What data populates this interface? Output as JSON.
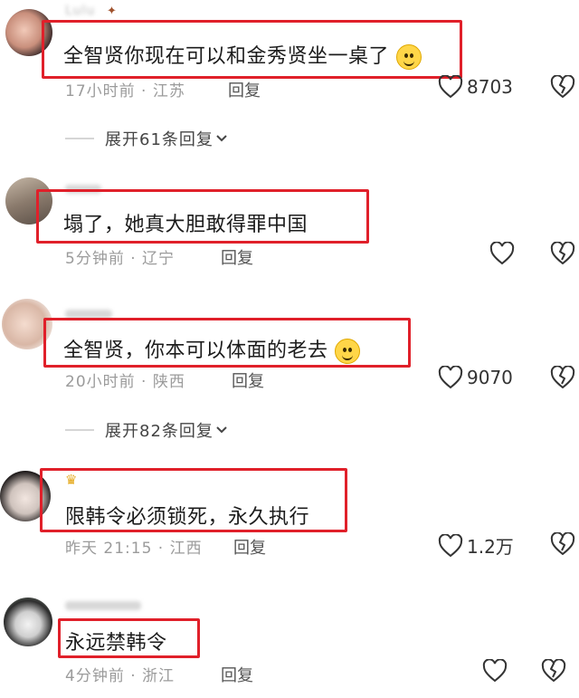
{
  "comments": [
    {
      "user": "Lulu",
      "text": "全智贤你现在可以和金秀贤坐一桌了",
      "has_emoji": true,
      "time": "17小时前 · 江苏",
      "reply": "回复",
      "likes": "8703",
      "liked_filled": false
    },
    {
      "user": "",
      "text": "塌了，她真大胆敢得罪中国",
      "has_emoji": false,
      "time": "5分钟前 · 辽宁",
      "reply": "回复",
      "likes": "",
      "liked_filled": false
    },
    {
      "user": "",
      "text": "全智贤，你本可以体面的老去",
      "has_emoji": true,
      "time": "20小时前 · 陕西",
      "reply": "回复",
      "likes": "9070",
      "liked_filled": false
    },
    {
      "user": "",
      "text": "限韩令必须锁死，永久执行",
      "has_emoji": false,
      "time": "昨天 21:15 · 江西",
      "reply": "回复",
      "likes": "1.2万",
      "liked_filled": false
    },
    {
      "user": "",
      "text": "永远禁韩令",
      "has_emoji": false,
      "time": "4分钟前 · 浙江",
      "reply": "回复",
      "likes": "",
      "liked_filled": false
    }
  ],
  "expand_1": "展开61条回复",
  "expand_2": "展开82条回复",
  "highlight_color": "#e0202a",
  "icons": {
    "like": "heart-outline-icon",
    "dislike": "broken-heart-icon",
    "expand": "chevron-down-icon"
  }
}
